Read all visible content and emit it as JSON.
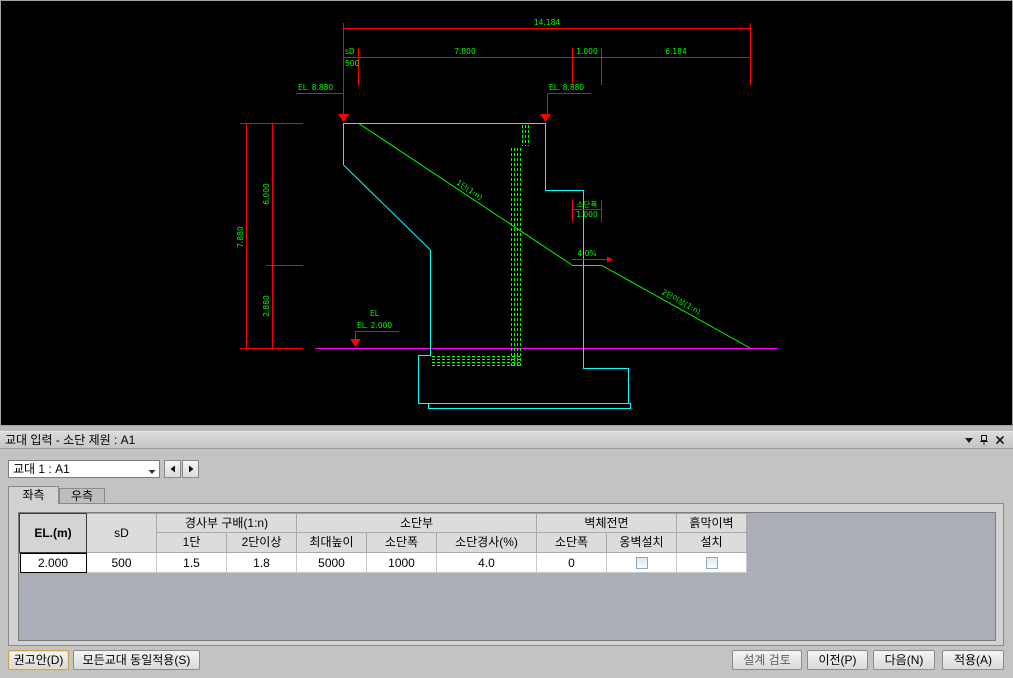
{
  "cad": {
    "colors": {
      "background": "#000000",
      "dimension": "#ff0000",
      "text": "#00ff00",
      "structure": "#00ffff",
      "rebar": "#00ff00",
      "slope": "#00ff00",
      "ground_line": "#ff00ff"
    },
    "dim_total": "14.184",
    "dim_sd_label": "sD",
    "dim_sd_value": "500",
    "dim_seg1": "7.800",
    "dim_seg2": "1.000",
    "dim_seg3": "6.184",
    "el_top_left": "EL. 8.880",
    "el_top_right": "EL. 8.880",
    "dim_height_total": "7.880",
    "dim_height_upper": "6.000",
    "dim_height_lower": "2.880",
    "el_label": "EL",
    "el_ground": "EL. 2.000",
    "slope1_label": "1단(1:n)",
    "slope2_label": "2단이상(1:n)",
    "berm_width_label": "소단폭",
    "berm_width_value": "1.000",
    "berm_slope_label": "4.0%"
  },
  "panel": {
    "title": "교대 입력 - 소단 제원 : A1",
    "title_icons": [
      "dropdown-icon",
      "pin-icon",
      "close-icon"
    ],
    "abutment_select": {
      "value": "교대 1 : A1",
      "icon": "chevron-down-icon"
    },
    "nav_icons": [
      "arrow-left-icon",
      "arrow-right-icon"
    ],
    "tabs": [
      {
        "label": "좌측",
        "active": true
      },
      {
        "label": "우측",
        "active": false
      }
    ],
    "table": {
      "headers": {
        "el": "EL.(m)",
        "sd": "sD",
        "slope_group": "경사부 구배(1:n)",
        "slope_1": "1단",
        "slope_2": "2단이상",
        "berm_group": "소단부",
        "berm_max_height": "최대높이",
        "berm_width": "소단폭",
        "berm_slope": "소단경사(%)",
        "wall_front_group": "벽체전면",
        "wall_front_width": "소단폭",
        "wall_front_retaining": "옹벽설치",
        "earth_wall_group": "흙막이벽",
        "earth_wall_install": "설치"
      },
      "rows": [
        {
          "el": "2.000",
          "sd": "500",
          "slope_1": "1.5",
          "slope_2": "1.8",
          "berm_max_height": "5000",
          "berm_width": "1000",
          "berm_slope": "4.0",
          "wall_front_width": "0",
          "wall_front_retaining": false,
          "earth_wall_install": false
        }
      ]
    },
    "buttons": {
      "recommend": "권고안(D)",
      "apply_all": "모든교대 동일적용(S)",
      "design_check": "설계 검토",
      "prev": "이전(P)",
      "next": "다음(N)",
      "apply": "적용(A)"
    }
  }
}
